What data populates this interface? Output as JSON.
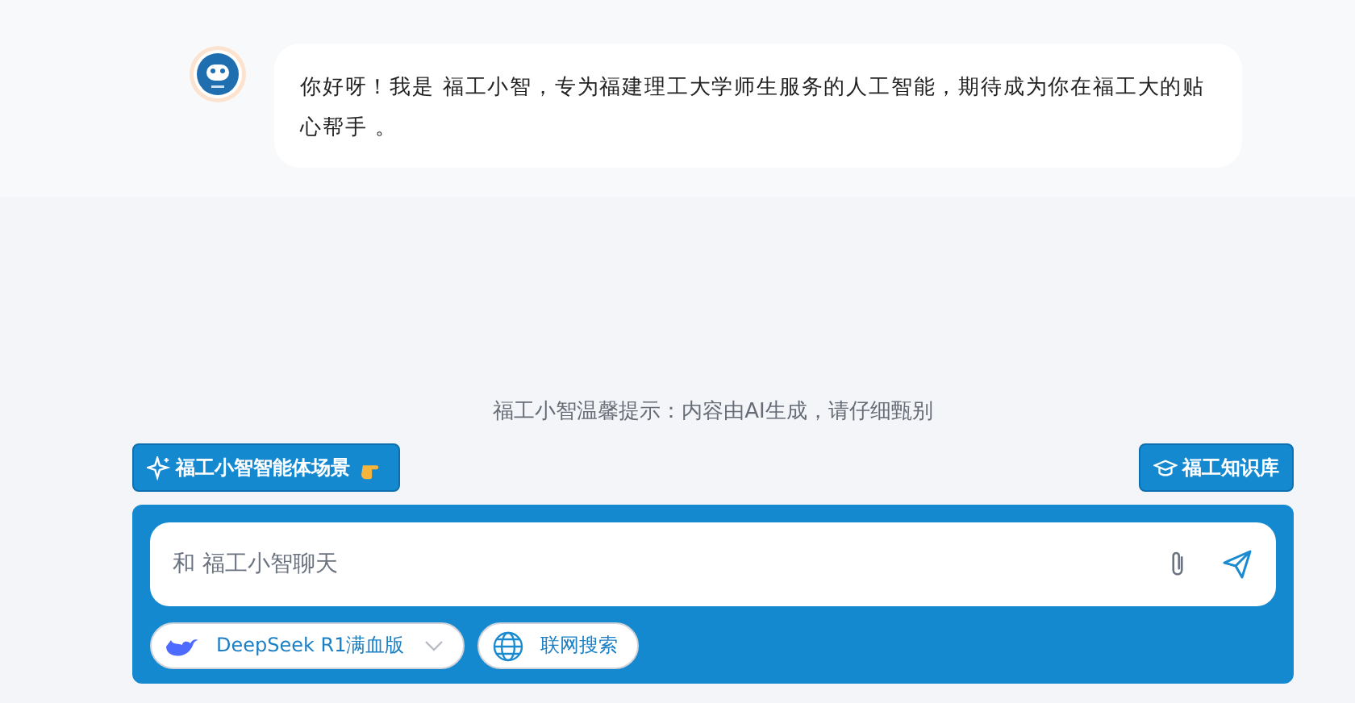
{
  "message": {
    "text": "你好呀！我是 福工小智，专为福建理工大学师生服务的人工智能，期待成为你在福工大的贴心帮手 。"
  },
  "notice": "福工小智温馨提示：内容由AI生成，请仔细甄别",
  "scene_button": {
    "label": "福工小智智能体场景"
  },
  "knowledge_button": {
    "label": "福工知识库"
  },
  "composer": {
    "placeholder": "和 福工小智聊天",
    "model": "DeepSeek R1满血版",
    "web_search": "联网搜索"
  }
}
